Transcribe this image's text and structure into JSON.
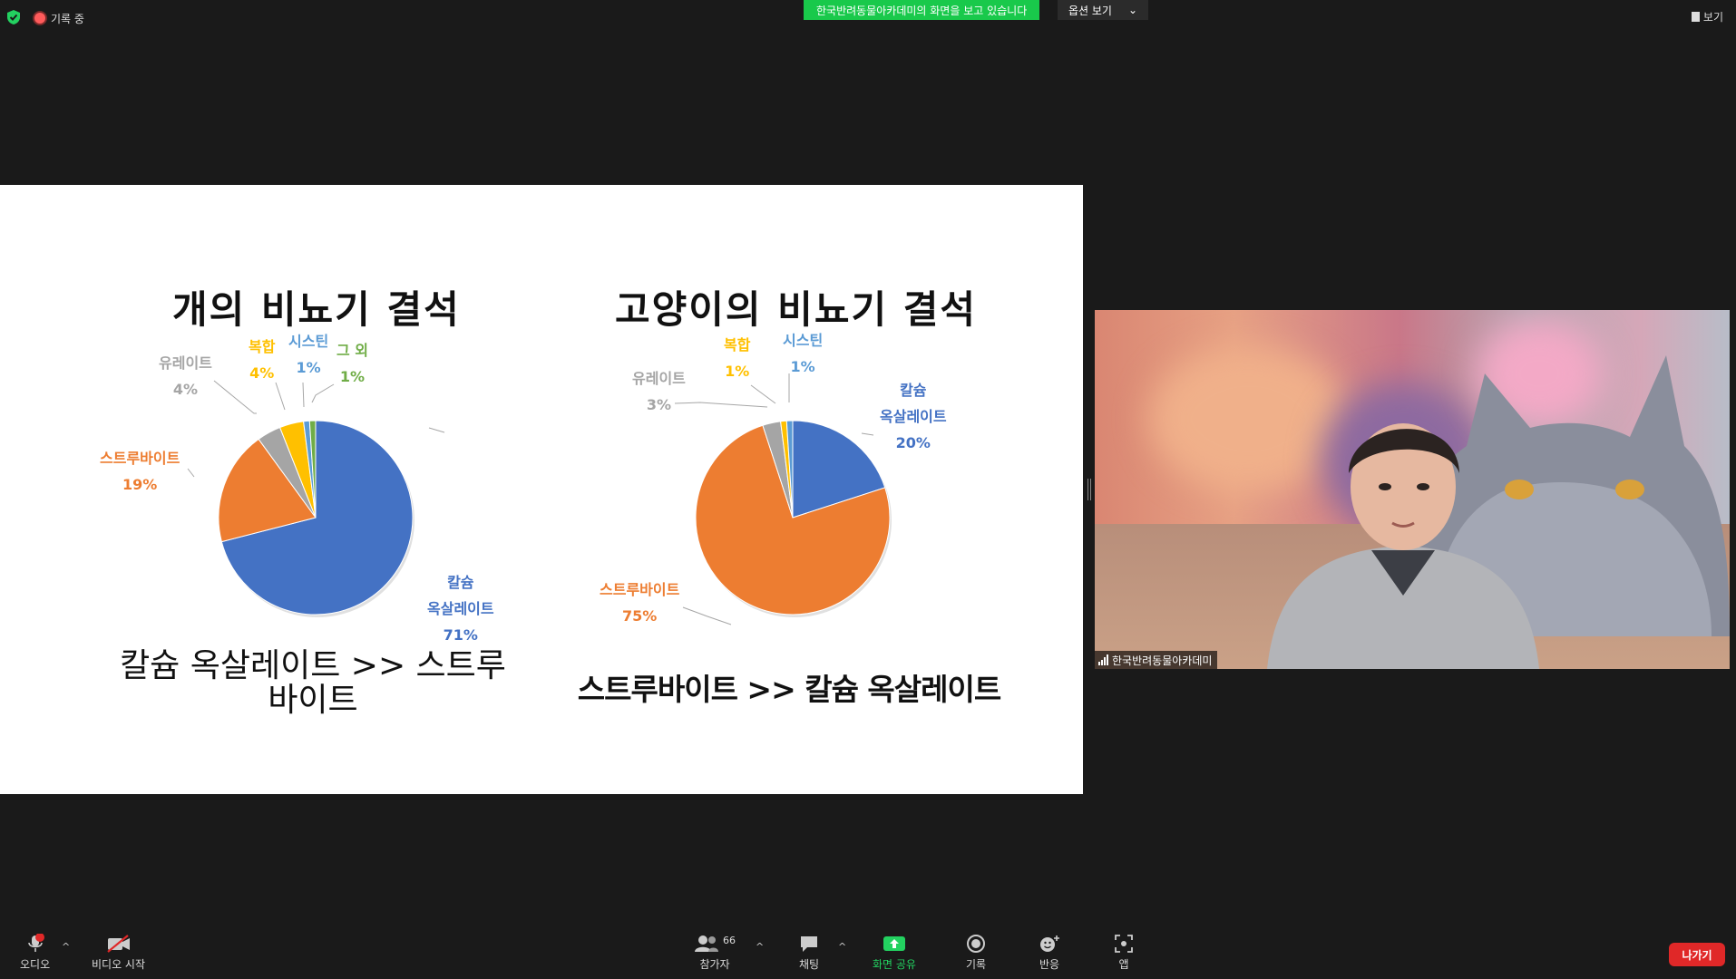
{
  "top_bar": {
    "recording_label": "기록 중",
    "share_banner": "한국반려동물아카데미의 화면을 보고 있습니다",
    "view_options_label": "옵션 보기",
    "view_label": "보기"
  },
  "slide": {
    "left_title": "개의 비뇨기 결석",
    "left_subtitle_line1": "칼슘 옥살레이트 >> 스트루",
    "left_subtitle_line2": "바이트",
    "right_title": "고양이의 비뇨기 결석",
    "right_subtitle": "스트루바이트 >> 칼슘 옥살레이트"
  },
  "chart_data": [
    {
      "type": "pie",
      "title": "개의 비뇨기 결석",
      "series": [
        {
          "name": "칼슘 옥살레이트",
          "value": 71,
          "label": "71%",
          "color": "#4472c4"
        },
        {
          "name": "스트루바이트",
          "value": 19,
          "label": "19%",
          "color": "#ed7d31"
        },
        {
          "name": "유레이트",
          "value": 4,
          "label": "4%",
          "color": "#a5a5a5"
        },
        {
          "name": "복합",
          "value": 4,
          "label": "4%",
          "color": "#ffc000"
        },
        {
          "name": "시스틴",
          "value": 1,
          "label": "1%",
          "color": "#5b9bd5"
        },
        {
          "name": "그 외",
          "value": 1,
          "label": "1%",
          "color": "#70ad47"
        }
      ],
      "labels": {
        "ca": [
          "칼슘",
          "옥살레이트",
          "71%"
        ],
        "st": [
          "스트루바이트",
          "19%"
        ],
        "ur": [
          "유레이트",
          "4%"
        ],
        "co": [
          "복합",
          "4%"
        ],
        "cy": [
          "시스틴",
          "1%"
        ],
        "ot": [
          "그 외",
          "1%"
        ]
      }
    },
    {
      "type": "pie",
      "title": "고양이의 비뇨기 결석",
      "series": [
        {
          "name": "칼슘 옥살레이트",
          "value": 20,
          "label": "20%",
          "color": "#4472c4"
        },
        {
          "name": "스트루바이트",
          "value": 75,
          "label": "75%",
          "color": "#ed7d31"
        },
        {
          "name": "유레이트",
          "value": 3,
          "label": "3%",
          "color": "#a5a5a5"
        },
        {
          "name": "복합",
          "value": 1,
          "label": "1%",
          "color": "#ffc000"
        },
        {
          "name": "시스틴",
          "value": 1,
          "label": "1%",
          "color": "#5b9bd5"
        }
      ],
      "labels": {
        "ca": [
          "칼슘",
          "옥살레이트",
          "20%"
        ],
        "st": [
          "스트루바이트",
          "75%"
        ],
        "ur": [
          "유레이트",
          "3%"
        ],
        "co": [
          "복합",
          "1%"
        ],
        "cy": [
          "시스틴",
          "1%"
        ]
      }
    }
  ],
  "video": {
    "participant_name": "한국반려동물아카데미"
  },
  "toolbar": {
    "audio_label": "오디오",
    "audio_alert": "!",
    "video_label": "비디오 시작",
    "participants_label": "참가자",
    "participants_count": "66",
    "chat_label": "채팅",
    "share_label": "화면 공유",
    "record_label": "기록",
    "reactions_label": "반응",
    "apps_label": "앱",
    "leave_label": "나가기"
  }
}
